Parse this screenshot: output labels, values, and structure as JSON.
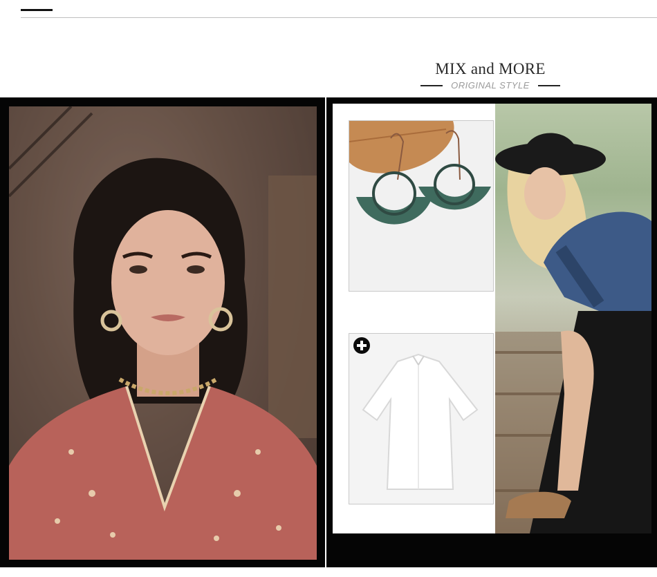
{
  "heading": {
    "title": "MIX and MORE",
    "subtitle": "ORIGINAL STYLE"
  },
  "icons": {
    "add": "plus-circle-icon"
  },
  "colors": {
    "frame": "#050505",
    "blouse": "#b8625a",
    "earring_patina": "#3f6b5e",
    "hat": "#1a1a1a",
    "denim": "#3d5a87"
  }
}
